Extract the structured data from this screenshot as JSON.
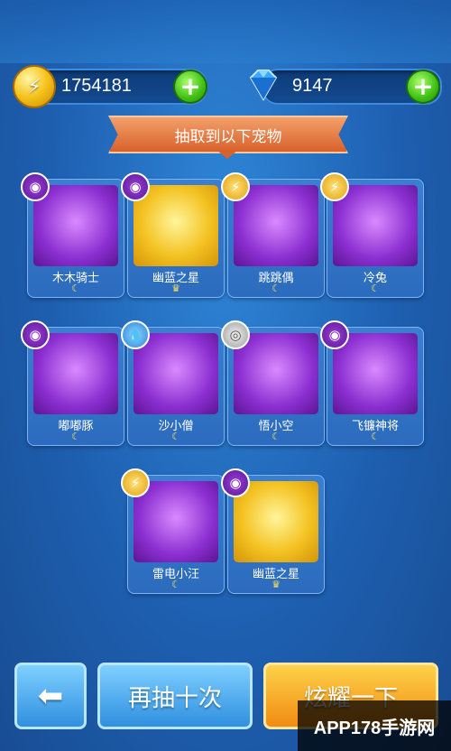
{
  "currency": {
    "gold_value": "1754181",
    "gem_value": "9147",
    "gold_icon": "lightning-coin-icon",
    "gem_icon": "diamond-icon"
  },
  "banner": {
    "title": "抽取到以下宠物"
  },
  "pets": [
    {
      "name": "木木骑士",
      "element": "dark",
      "rarity": "purple",
      "star": "☾"
    },
    {
      "name": "幽蓝之星",
      "element": "dark",
      "rarity": "gold",
      "star": "♛"
    },
    {
      "name": "跳跳偶",
      "element": "thunder",
      "rarity": "purple",
      "star": "☾"
    },
    {
      "name": "冷兔",
      "element": "thunder",
      "rarity": "purple",
      "star": "☾"
    },
    {
      "name": "嘟嘟豚",
      "element": "dark",
      "rarity": "purple",
      "star": "☾"
    },
    {
      "name": "沙小僧",
      "element": "water",
      "rarity": "purple",
      "star": "☾"
    },
    {
      "name": "悟小空",
      "element": "wind",
      "rarity": "purple",
      "star": "☾"
    },
    {
      "name": "飞镰神将",
      "element": "dark",
      "rarity": "purple",
      "star": "☾"
    },
    {
      "name": "雷电小汪",
      "element": "thunder",
      "rarity": "purple",
      "star": "☾"
    },
    {
      "name": "幽蓝之星",
      "element": "dark",
      "rarity": "gold",
      "star": "♛"
    }
  ],
  "buttons": {
    "back_label": "⬅",
    "draw_again_label": "再抽十次",
    "share_label": "炫耀一下"
  },
  "watermark": "APP178手游网"
}
